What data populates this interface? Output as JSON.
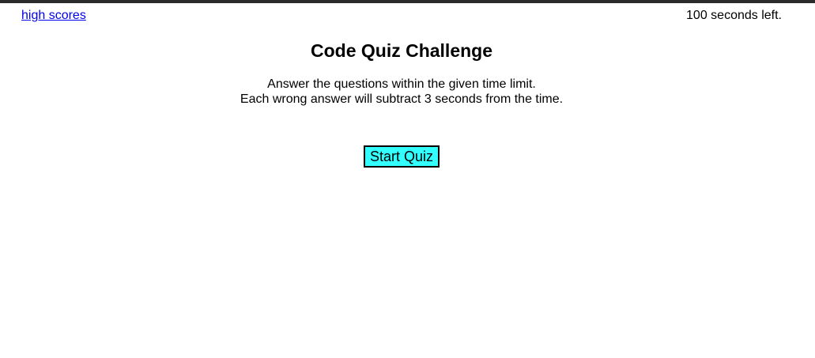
{
  "header": {
    "high_scores_label": "high scores",
    "timer_text": "100 seconds left."
  },
  "main": {
    "title": "Code Quiz Challenge",
    "instructions_line1": "Answer the questions within the given time limit.",
    "instructions_line2": "Each wrong answer will subtract 3 seconds from the time.",
    "start_button_label": "Start Quiz"
  },
  "colors": {
    "top_border": "#2b2b2b",
    "link": "#0000ee",
    "start_button_bg": "#33ffff"
  }
}
